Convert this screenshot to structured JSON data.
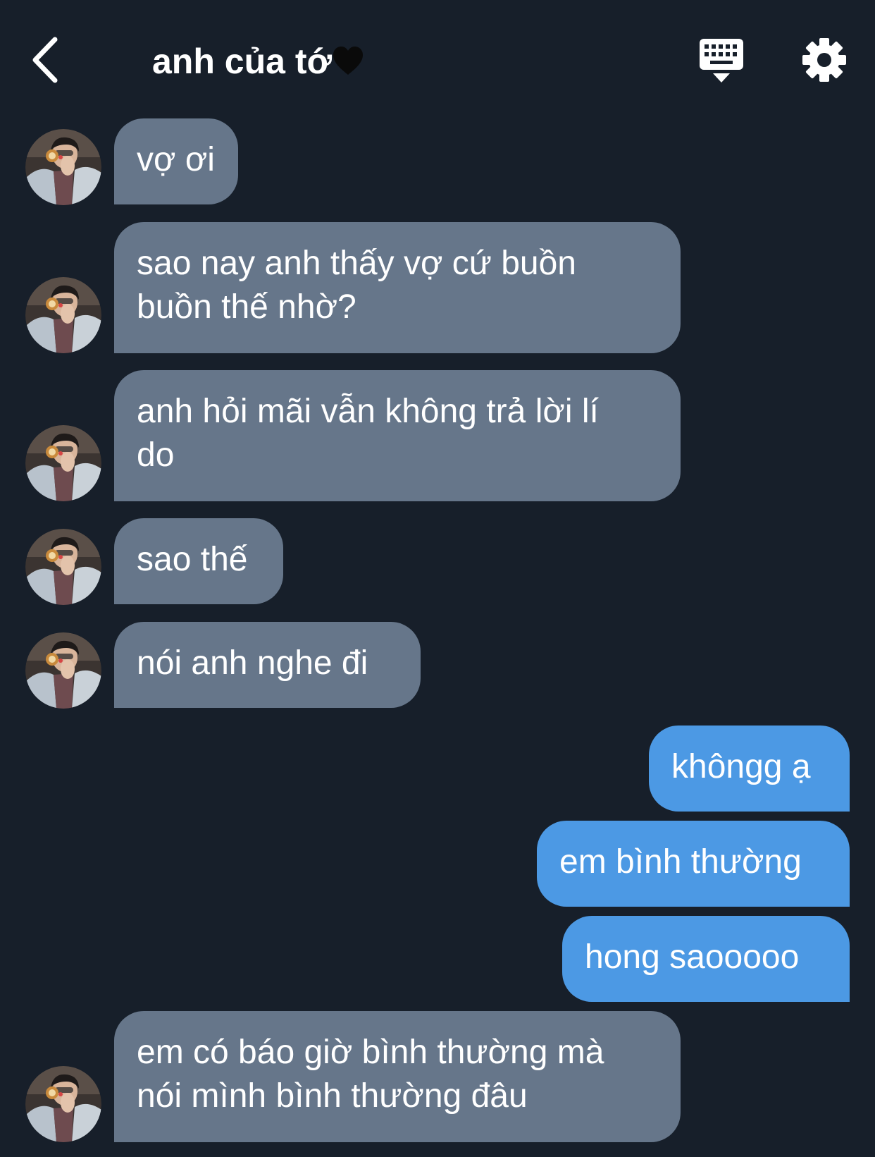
{
  "header": {
    "title": "anh của tớ",
    "back_icon": "chevron-left-icon",
    "heart_icon": "black-heart-icon",
    "keyboard_icon": "keyboard-hide-icon",
    "settings_icon": "gear-icon"
  },
  "colors": {
    "background": "#171f2a",
    "incoming_bubble": "#66768a",
    "outgoing_bubble": "#4c99e4",
    "text": "#ffffff"
  },
  "messages": [
    {
      "direction": "incoming",
      "lines": [
        "vợ ơi"
      ]
    },
    {
      "direction": "incoming",
      "lines": [
        "sao nay anh thấy vợ cứ buồn",
        "buồn thế nhờ?"
      ]
    },
    {
      "direction": "incoming",
      "lines": [
        "anh hỏi mãi vẫn không trả lời lí",
        "do"
      ]
    },
    {
      "direction": "incoming",
      "lines": [
        "sao thế"
      ]
    },
    {
      "direction": "incoming",
      "lines": [
        "nói anh nghe đi"
      ]
    },
    {
      "direction": "outgoing",
      "lines": [
        "khôngg ạ"
      ]
    },
    {
      "direction": "outgoing",
      "lines": [
        "em bình thường"
      ]
    },
    {
      "direction": "outgoing",
      "lines": [
        "hong saooooo"
      ]
    },
    {
      "direction": "incoming",
      "lines": [
        "em có báo giờ bình thường mà",
        "nói mình bình thường đâu"
      ]
    }
  ]
}
